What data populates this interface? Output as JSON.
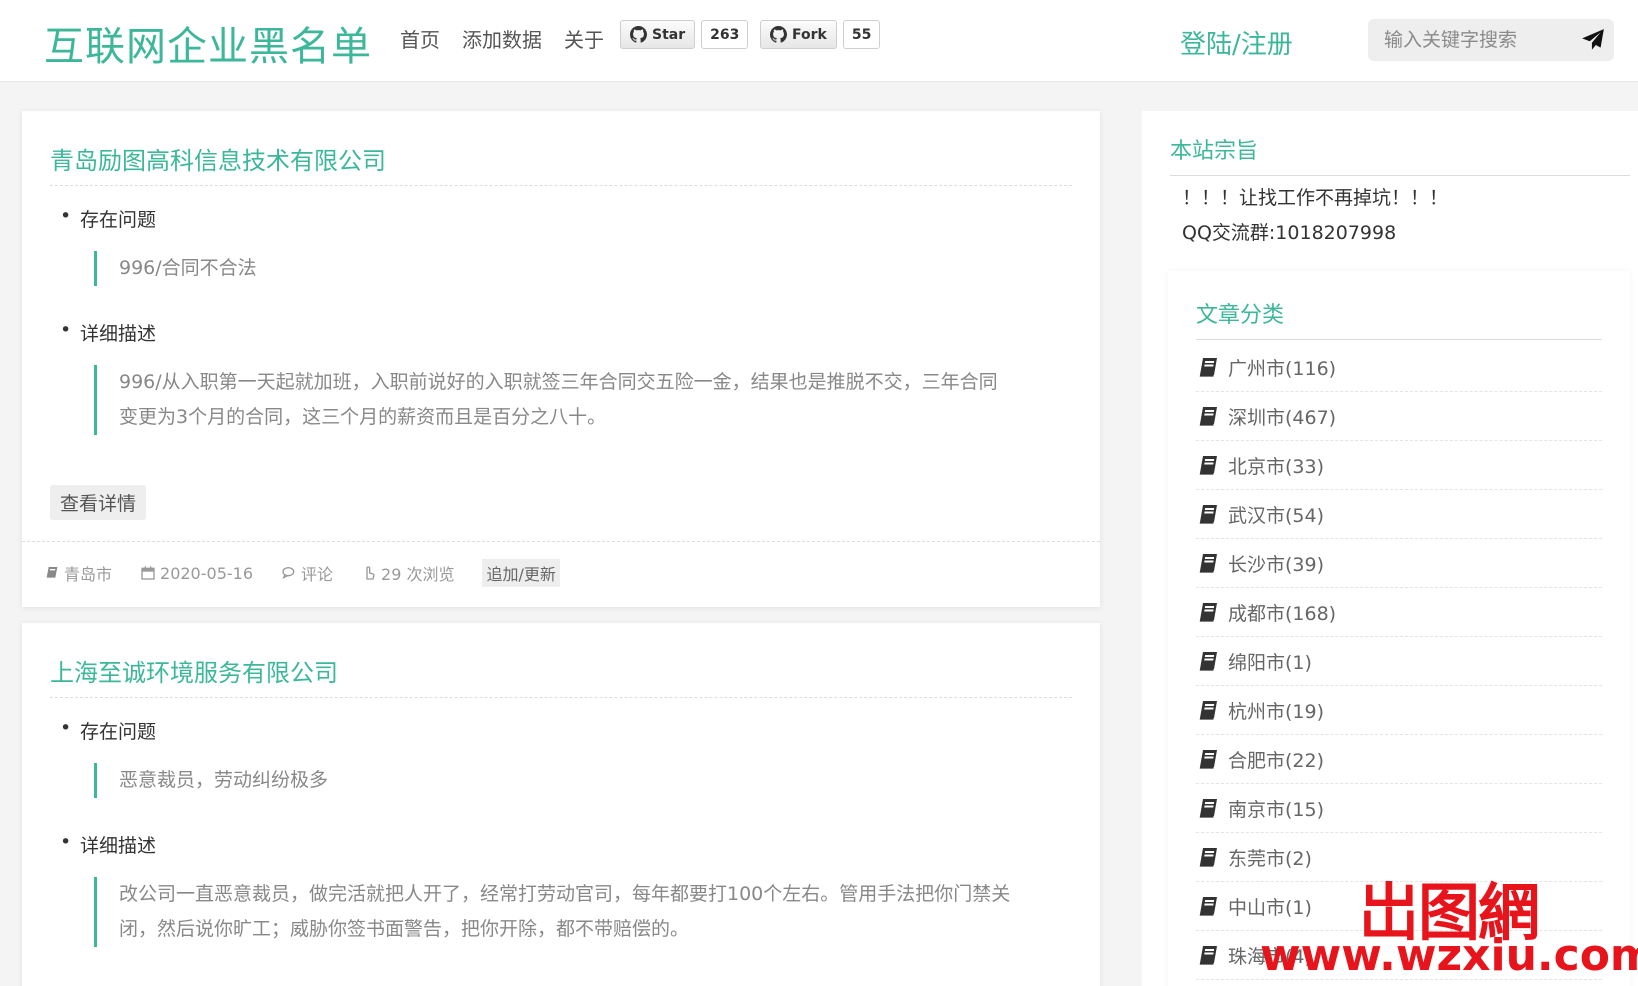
{
  "header": {
    "logo": "互联网企业黑名单",
    "nav": [
      "首页",
      "添加数据",
      "关于"
    ],
    "github_star": {
      "label": "Star",
      "count": "263"
    },
    "github_fork": {
      "label": "Fork",
      "count": "55"
    },
    "login": "登陆/注册",
    "search_placeholder": "输入关键字搜索"
  },
  "posts": [
    {
      "title": "青岛励图高科信息技术有限公司",
      "problem_label": "存在问题",
      "problem": "996/合同不合法",
      "detail_label": "详细描述",
      "detail": "996/从入职第一天起就加班，入职前说好的入职就签三年合同交五险一金，结果也是推脱不交，三年合同变更为3个月的合同，这三个月的薪资而且是百分之八十。",
      "detail_button": "查看详情",
      "city": "青岛市",
      "date": "2020-05-16",
      "comment": "评论",
      "views": "29 次浏览",
      "update": "追加/更新"
    },
    {
      "title": "上海至诚环境服务有限公司",
      "problem_label": "存在问题",
      "problem": "恶意裁员，劳动纠纷极多",
      "detail_label": "详细描述",
      "detail": "改公司一直恶意裁员，做完活就把人开了，经常打劳动官司，每年都要打100个左右。管用手法把你门禁关闭，然后说你旷工；威胁你签书面警告，把你开除，都不带赔偿的。"
    }
  ],
  "sidebar": {
    "about_title": "本站宗旨",
    "motto_line1": "！！！让找工作不再掉坑！！！",
    "motto_line2": "QQ交流群:1018207998",
    "category_title": "文章分类",
    "categories": [
      "广州市(116)",
      "深圳市(467)",
      "北京市(33)",
      "武汉市(54)",
      "长沙市(39)",
      "成都市(168)",
      "绵阳市(1)",
      "杭州市(19)",
      "合肥市(22)",
      "南京市(15)",
      "东莞市(2)",
      "中山市(1)",
      "珠海市(4)"
    ]
  },
  "watermark": {
    "top": "岀图網",
    "bottom": "www.wzxiu.com"
  },
  "colors": {
    "accent": "#3cb79a",
    "watermark": "#e8141c"
  }
}
